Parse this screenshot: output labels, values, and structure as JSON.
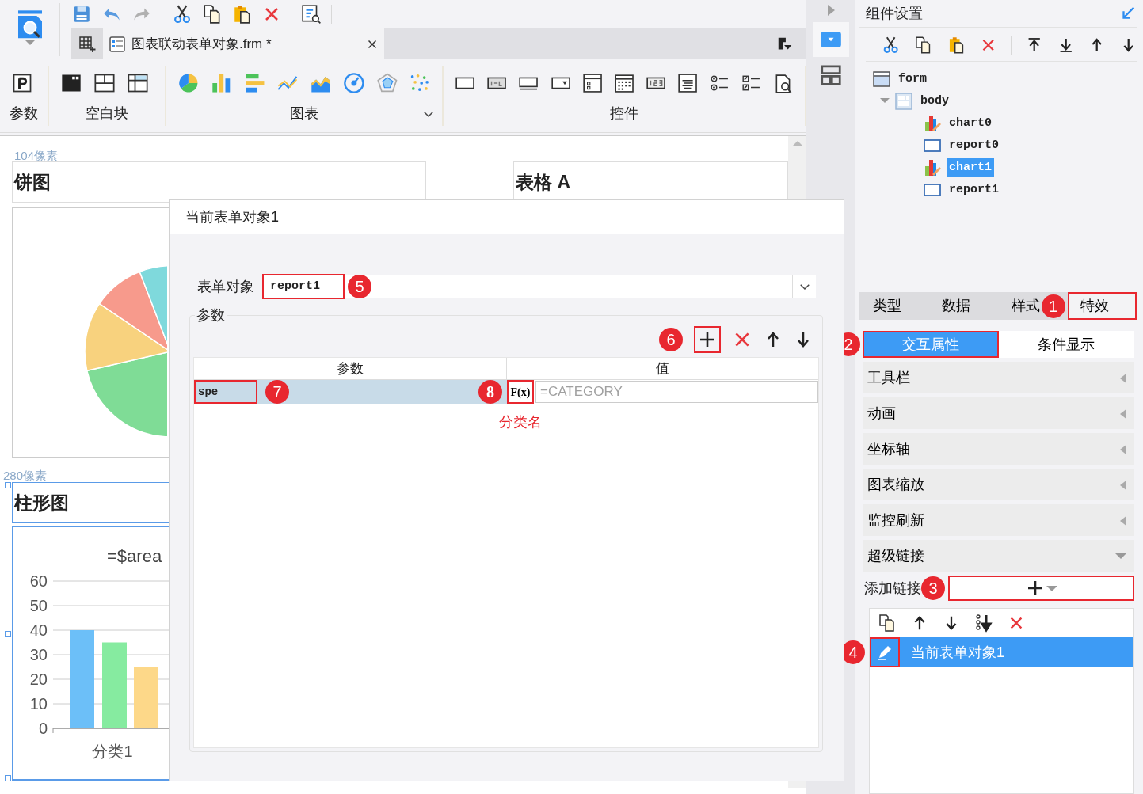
{
  "app": {
    "file_tab": {
      "title": "图表联动表单对象.frm *"
    },
    "ribbon": {
      "groups": [
        {
          "label": "参数"
        },
        {
          "label": "空白块"
        },
        {
          "label": "图表"
        },
        {
          "label": "控件"
        }
      ]
    }
  },
  "canvas": {
    "size_labels": [
      "104像素",
      "280像素"
    ],
    "widgets": [
      {
        "kind": "pie",
        "title": "饼图",
        "selected": false
      },
      {
        "kind": "table",
        "title": "表格 A",
        "selected": false
      },
      {
        "kind": "bar",
        "title": "柱形图",
        "selected": true,
        "chart_data": {
          "type": "bar",
          "grid": true,
          "title": "=$area",
          "categories": [
            "分类1"
          ],
          "ylim": [
            0,
            60
          ],
          "yticks": [
            0,
            10,
            20,
            30,
            40,
            50,
            60
          ],
          "series": [
            {
              "color": "#6cbff8",
              "values": [
                40
              ]
            },
            {
              "color": "#86eba0",
              "values": [
                35
              ]
            },
            {
              "color": "#fdd889",
              "values": [
                25
              ]
            }
          ]
        }
      }
    ]
  },
  "dialog": {
    "title": "当前表单对象1",
    "form_object": {
      "label": "表单对象",
      "value": "report1",
      "callout": "5"
    },
    "params": {
      "label": "参数",
      "toolbar_callout": "6",
      "columns": [
        "参数",
        "值"
      ],
      "rows": [
        {
          "name": "spe",
          "selected": true,
          "name_callout": "7",
          "formula_button": "F(x)",
          "formula_callout": "8",
          "value": "=CATEGORY"
        }
      ],
      "note": "分类名"
    }
  },
  "panel": {
    "title": "组件设置",
    "tree": [
      {
        "label": "form",
        "kind": "form",
        "selected": false,
        "children": [
          {
            "label": "body",
            "kind": "body",
            "selected": false,
            "children": [
              {
                "label": "chart0",
                "kind": "chart",
                "selected": false
              },
              {
                "label": "report0",
                "kind": "report",
                "selected": false
              },
              {
                "label": "chart1",
                "kind": "chart",
                "selected": true
              },
              {
                "label": "report1",
                "kind": "report",
                "selected": false
              }
            ]
          }
        ]
      }
    ],
    "tabs": [
      {
        "label": "类型",
        "selected": false
      },
      {
        "label": "数据",
        "selected": false
      },
      {
        "label": "样式",
        "selected": false
      },
      {
        "label": "特效",
        "selected": true,
        "callout": "1"
      }
    ],
    "subtabs": [
      {
        "label": "交互属性",
        "selected": true,
        "callout": "2"
      },
      {
        "label": "条件显示",
        "selected": false
      }
    ],
    "sections": [
      {
        "label": "工具栏",
        "expanded": false
      },
      {
        "label": "动画",
        "expanded": false
      },
      {
        "label": "坐标轴",
        "expanded": false
      },
      {
        "label": "图表缩放",
        "expanded": false
      },
      {
        "label": "监控刷新",
        "expanded": false
      },
      {
        "label": "超级链接",
        "expanded": true
      }
    ],
    "add_link": {
      "label": "添加链接",
      "callout": "3"
    },
    "links": [
      {
        "label": "当前表单对象1",
        "selected": true,
        "callout": "4"
      }
    ]
  }
}
